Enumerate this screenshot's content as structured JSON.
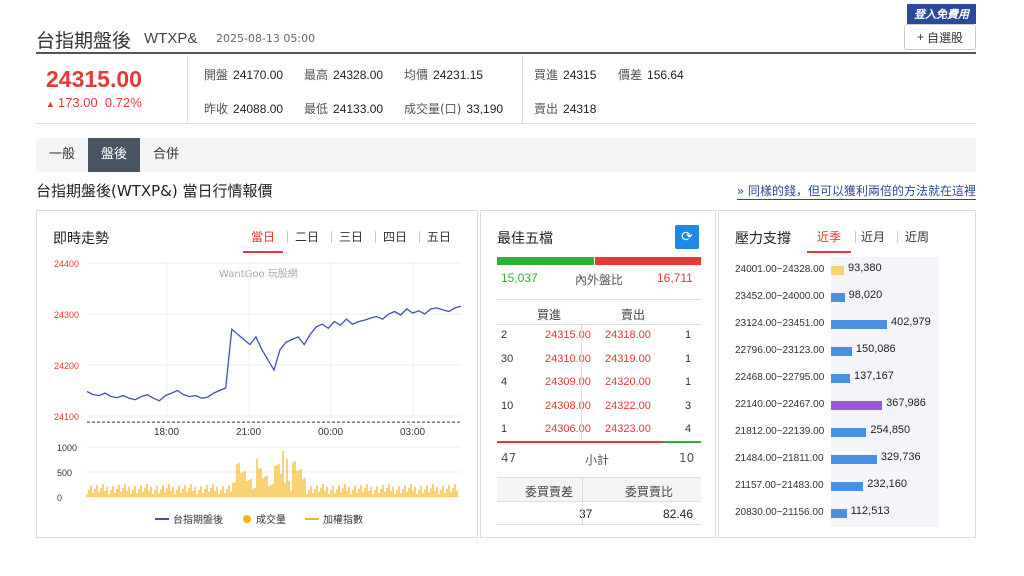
{
  "header": {
    "title": "台指期盤後",
    "code": "WTXP&",
    "datetime": "2025-08-13 05:00",
    "badge": "登入免費用",
    "add_button": "自選股"
  },
  "quote": {
    "price": "24315.00",
    "change": "173.00",
    "change_pct": "0.72%",
    "cells": [
      {
        "label": "開盤",
        "value": "24170.00"
      },
      {
        "label": "最高",
        "value": "24328.00"
      },
      {
        "label": "均價",
        "value": "24231.15"
      },
      {
        "label": "昨收",
        "value": "24088.00"
      },
      {
        "label": "最低",
        "value": "24133.00"
      },
      {
        "label": "成交量(口)",
        "value": "33,190"
      }
    ],
    "cells_right": [
      {
        "label": "買進",
        "value": "24315"
      },
      {
        "label": "價差",
        "value": "156.64"
      },
      {
        "label": "賣出",
        "value": "24318"
      }
    ]
  },
  "tabs": [
    "一般",
    "盤後",
    "合併"
  ],
  "active_tab": 1,
  "section_title": "台指期盤後(WTXP&) 當日行情報價",
  "promo_link": "» 同樣的錢，但可以獲利兩倍的方法就在這裡",
  "trend": {
    "title": "即時走勢",
    "range_tabs": [
      "當日",
      "二日",
      "三日",
      "四日",
      "五日"
    ],
    "active_range": 0,
    "watermark": "WantGoo 玩股網",
    "legend": [
      "台指期盤後",
      "成交量",
      "加權指數"
    ]
  },
  "chart_data": {
    "type": "line",
    "y_ticks": [
      "24400",
      "24300",
      "24200",
      "24100"
    ],
    "ylim": [
      24100,
      24400
    ],
    "x_ticks": [
      "18:00",
      "21:00",
      "00:00",
      "03:00"
    ],
    "reference_line": 24088,
    "vol_ticks": [
      "1000",
      "500",
      "0"
    ],
    "vol_ylim": [
      0,
      1000
    ],
    "series": [
      {
        "values": [
          24148,
          24142,
          24140,
          24145,
          24138,
          24136,
          24140,
          24135,
          24132,
          24138,
          24142,
          24135,
          24130,
          24140,
          24145,
          24150,
          24142,
          24138,
          24140,
          24135,
          24137,
          24145,
          24150,
          24155,
          24270,
          24260,
          24250,
          24240,
          24255,
          24230,
          24210,
          24190,
          24230,
          24245,
          24250,
          24255,
          24240,
          24260,
          24275,
          24280,
          24272,
          24285,
          24278,
          24290,
          24280,
          24285,
          24288,
          24292,
          24295,
          24290,
          24300,
          24305,
          24298,
          24310,
          24302,
          24306,
          24300,
          24310,
          24312,
          24308,
          24305,
          24312,
          24315
        ]
      }
    ]
  },
  "orderbook": {
    "title": "最佳五檔",
    "out_vol": "15,037",
    "ratio_label": "內外盤比",
    "in_vol": "16,711",
    "buy_label": "買進",
    "sell_label": "賣出",
    "rows": [
      {
        "bq": "2",
        "bp": "24315.00",
        "ap": "24318.00",
        "aq": "1"
      },
      {
        "bq": "30",
        "bp": "24310.00",
        "ap": "24319.00",
        "aq": "1"
      },
      {
        "bq": "4",
        "bp": "24309.00",
        "ap": "24320.00",
        "aq": "1"
      },
      {
        "bq": "10",
        "bp": "24308.00",
        "ap": "24322.00",
        "aq": "3"
      },
      {
        "bq": "1",
        "bp": "24306.00",
        "ap": "24323.00",
        "aq": "4"
      }
    ],
    "total_buy": "47",
    "total_label": "小計",
    "total_sell": "10",
    "spread_label": "委買賣差",
    "ratio2_label": "委買賣比",
    "spread_value": "37",
    "ratio2_value": "82.46"
  },
  "pressure": {
    "title": "壓力支撐",
    "tabs": [
      "近季",
      "近月",
      "近周"
    ],
    "active": 0,
    "max": 402979,
    "rows": [
      {
        "range": "24001.00~24328.00",
        "value": 93380,
        "label": "93,380",
        "color": "#f6d270"
      },
      {
        "range": "23452.00~24000.00",
        "value": 98020,
        "label": "98,020",
        "color": "#4a90e2"
      },
      {
        "range": "23124.00~23451.00",
        "value": 402979,
        "label": "402,979",
        "color": "#4a90e2"
      },
      {
        "range": "22796.00~23123.00",
        "value": 150086,
        "label": "150,086",
        "color": "#4a90e2"
      },
      {
        "range": "22468.00~22795.00",
        "value": 137167,
        "label": "137,167",
        "color": "#4a90e2"
      },
      {
        "range": "22140.00~22467.00",
        "value": 367986,
        "label": "367,986",
        "color": "#9b59d6"
      },
      {
        "range": "21812.00~22139.00",
        "value": 254850,
        "label": "254,850",
        "color": "#4a90e2"
      },
      {
        "range": "21484.00~21811.00",
        "value": 329736,
        "label": "329,736",
        "color": "#4a90e2"
      },
      {
        "range": "21157.00~21483.00",
        "value": 232160,
        "label": "232,160",
        "color": "#4a90e2"
      },
      {
        "range": "20830.00~21156.00",
        "value": 112513,
        "label": "112,513",
        "color": "#4a90e2"
      }
    ]
  },
  "colors": {
    "up": "#e53935",
    "down": "#2eaf3a",
    "line": "#3f51b5",
    "volume": "#f5b31b"
  }
}
